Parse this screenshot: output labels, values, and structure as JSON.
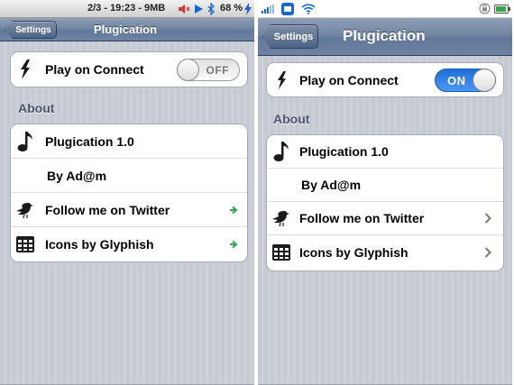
{
  "left": {
    "status": {
      "text": "2/3 - 19:23 - 9MB",
      "battery": "68 %",
      "icons": [
        "speaker-mute-icon",
        "play-icon",
        "bluetooth-icon",
        "charging-bolt-icon"
      ]
    },
    "nav": {
      "back_label": "Settings",
      "title": "Plugication"
    },
    "toggle": {
      "label": "Play on Connect",
      "state": "OFF",
      "icon": "lightning-icon"
    },
    "section_header": "About",
    "about_items": [
      {
        "label": "Plugication 1.0",
        "icon": "music-note-icon"
      },
      {
        "label": "By Ad@m"
      },
      {
        "label": "Follow me on Twitter",
        "icon": "bird-icon",
        "accessory": "green-arrow-icon"
      },
      {
        "label": "Icons by Glyphish",
        "icon": "calendar-grid-icon",
        "accessory": "green-arrow-icon"
      }
    ],
    "colors": {
      "accessory_arrow": "#2fa84f"
    }
  },
  "right": {
    "status": {
      "icons": [
        "signal-bars-icon",
        "app-badge-icon",
        "wifi-icon",
        "lock-rotation-icon",
        "battery-icon"
      ]
    },
    "nav": {
      "back_label": "Settings",
      "title": "Plugication"
    },
    "toggle": {
      "label": "Play on Connect",
      "state": "ON",
      "icon": "lightning-icon"
    },
    "section_header": "About",
    "about_items": [
      {
        "label": "Plugication 1.0",
        "icon": "music-note-icon"
      },
      {
        "label": "By Ad@m"
      },
      {
        "label": "Follow me on Twitter",
        "icon": "bird-icon",
        "accessory": "chevron-right-icon"
      },
      {
        "label": "Icons by Glyphish",
        "icon": "calendar-grid-icon",
        "accessory": "chevron-right-icon"
      }
    ],
    "colors": {
      "switch_on": "#2a7be4"
    }
  }
}
